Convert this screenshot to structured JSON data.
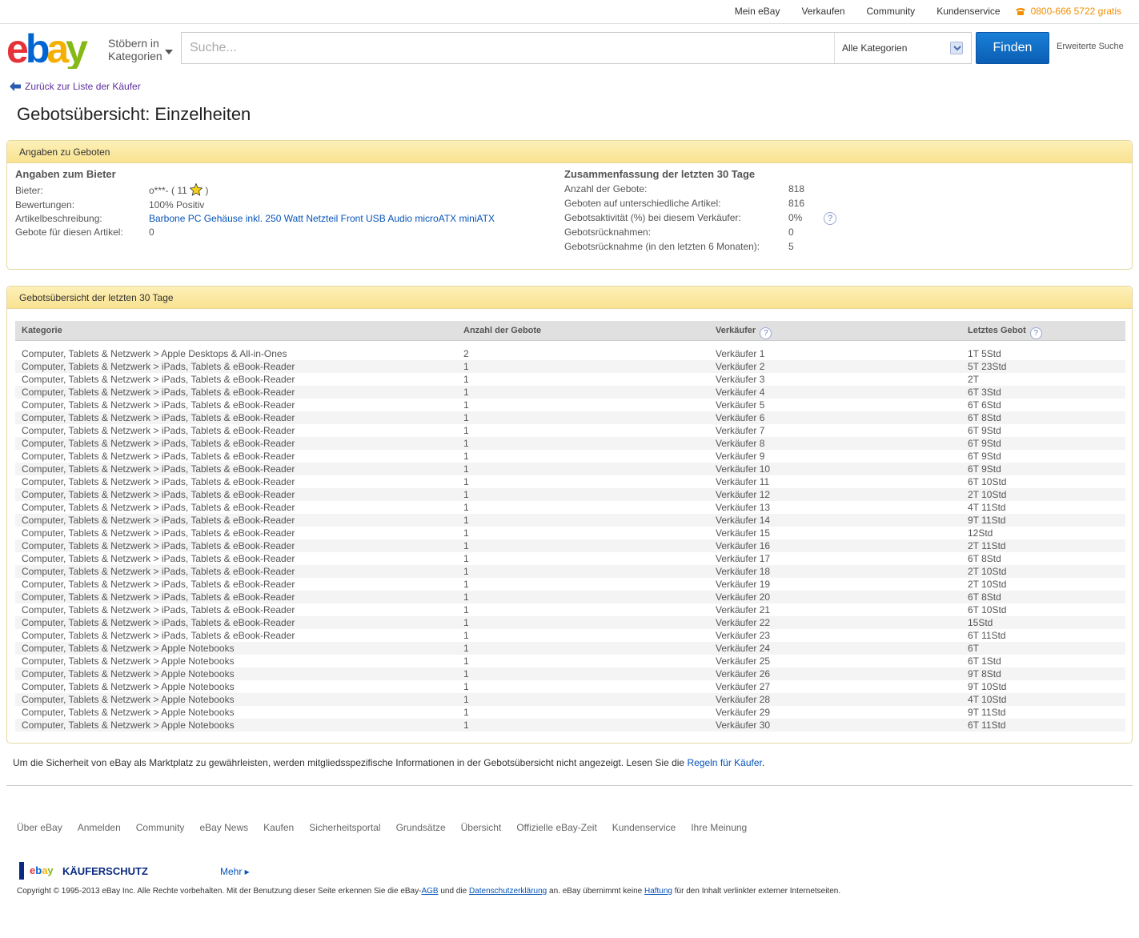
{
  "topnav": {
    "items": [
      "Mein eBay",
      "Verkaufen",
      "Community",
      "Kundenservice"
    ],
    "phone": "0800-666 5722 gratis"
  },
  "header": {
    "browse_line1": "Stöbern in",
    "browse_line2": "Kategorien",
    "search_placeholder": "Suche...",
    "category": "Alle Kategorien",
    "find_label": "Finden",
    "advanced_search": "Erweiterte Suche"
  },
  "back_link": "Zurück zur Liste der Käufer",
  "page_title": "Gebotsübersicht: Einzelheiten",
  "panel1": {
    "title": "Angaben zu Geboten",
    "bidder": {
      "heading": "Angaben zum Bieter",
      "bieter_label": "Bieter:",
      "bieter_value": "o***- ( 11",
      "bieter_close": ")",
      "bewertungen_label": "Bewertungen:",
      "bewertungen_value": "100% Positiv",
      "artikel_label": "Artikelbeschreibung:",
      "artikel_value": "Barbone PC Gehäuse inkl. 250 Watt Netzteil Front USB Audio microATX miniATX",
      "gebote_label": "Gebote für diesen Artikel:",
      "gebote_value": "0"
    },
    "summary": {
      "heading": "Zusammenfassung der letzten 30 Tage",
      "items": [
        {
          "label": "Anzahl der Gebote:",
          "value": "818"
        },
        {
          "label": "Geboten auf unterschiedliche Artikel:",
          "value": "816"
        },
        {
          "label": "Gebotsaktivität (%) bei diesem Verkäufer:",
          "value": "0%"
        },
        {
          "label": "Gebotsrücknahmen:",
          "value": "0"
        },
        {
          "label": "Gebotsrücknahme (in den letzten 6 Monaten):",
          "value": "5"
        }
      ]
    }
  },
  "panel2": {
    "title": "Gebotsübersicht der letzten 30 Tage",
    "columns": [
      "Kategorie",
      "Anzahl der Gebote",
      "Verkäufer",
      "Letztes Gebot"
    ],
    "rows": [
      [
        "Computer, Tablets & Netzwerk > Apple Desktops & All-in-Ones",
        "2",
        "Verkäufer 1",
        "1T 5Std"
      ],
      [
        "Computer, Tablets & Netzwerk > iPads, Tablets & eBook-Reader",
        "1",
        "Verkäufer 2",
        "5T 23Std"
      ],
      [
        "Computer, Tablets & Netzwerk > iPads, Tablets & eBook-Reader",
        "1",
        "Verkäufer 3",
        "2T"
      ],
      [
        "Computer, Tablets & Netzwerk > iPads, Tablets & eBook-Reader",
        "1",
        "Verkäufer 4",
        "6T 3Std"
      ],
      [
        "Computer, Tablets & Netzwerk > iPads, Tablets & eBook-Reader",
        "1",
        "Verkäufer 5",
        "6T 6Std"
      ],
      [
        "Computer, Tablets & Netzwerk > iPads, Tablets & eBook-Reader",
        "1",
        "Verkäufer 6",
        "6T 8Std"
      ],
      [
        "Computer, Tablets & Netzwerk > iPads, Tablets & eBook-Reader",
        "1",
        "Verkäufer 7",
        "6T 9Std"
      ],
      [
        "Computer, Tablets & Netzwerk > iPads, Tablets & eBook-Reader",
        "1",
        "Verkäufer 8",
        "6T 9Std"
      ],
      [
        "Computer, Tablets & Netzwerk > iPads, Tablets & eBook-Reader",
        "1",
        "Verkäufer 9",
        "6T 9Std"
      ],
      [
        "Computer, Tablets & Netzwerk > iPads, Tablets & eBook-Reader",
        "1",
        "Verkäufer 10",
        "6T 9Std"
      ],
      [
        "Computer, Tablets & Netzwerk > iPads, Tablets & eBook-Reader",
        "1",
        "Verkäufer 11",
        "6T 10Std"
      ],
      [
        "Computer, Tablets & Netzwerk > iPads, Tablets & eBook-Reader",
        "1",
        "Verkäufer 12",
        "2T 10Std"
      ],
      [
        "Computer, Tablets & Netzwerk > iPads, Tablets & eBook-Reader",
        "1",
        "Verkäufer 13",
        "4T 11Std"
      ],
      [
        "Computer, Tablets & Netzwerk > iPads, Tablets & eBook-Reader",
        "1",
        "Verkäufer 14",
        "9T 11Std"
      ],
      [
        "Computer, Tablets & Netzwerk > iPads, Tablets & eBook-Reader",
        "1",
        "Verkäufer 15",
        "12Std"
      ],
      [
        "Computer, Tablets & Netzwerk > iPads, Tablets & eBook-Reader",
        "1",
        "Verkäufer 16",
        "2T 11Std"
      ],
      [
        "Computer, Tablets & Netzwerk > iPads, Tablets & eBook-Reader",
        "1",
        "Verkäufer 17",
        "6T 8Std"
      ],
      [
        "Computer, Tablets & Netzwerk > iPads, Tablets & eBook-Reader",
        "1",
        "Verkäufer 18",
        "2T 10Std"
      ],
      [
        "Computer, Tablets & Netzwerk > iPads, Tablets & eBook-Reader",
        "1",
        "Verkäufer 19",
        "2T 10Std"
      ],
      [
        "Computer, Tablets & Netzwerk > iPads, Tablets & eBook-Reader",
        "1",
        "Verkäufer 20",
        "6T 8Std"
      ],
      [
        "Computer, Tablets & Netzwerk > iPads, Tablets & eBook-Reader",
        "1",
        "Verkäufer 21",
        "6T 10Std"
      ],
      [
        "Computer, Tablets & Netzwerk > iPads, Tablets & eBook-Reader",
        "1",
        "Verkäufer 22",
        "15Std"
      ],
      [
        "Computer, Tablets & Netzwerk > iPads, Tablets & eBook-Reader",
        "1",
        "Verkäufer 23",
        "6T 11Std"
      ],
      [
        "Computer, Tablets & Netzwerk > Apple Notebooks",
        "1",
        "Verkäufer 24",
        "6T"
      ],
      [
        "Computer, Tablets & Netzwerk > Apple Notebooks",
        "1",
        "Verkäufer 25",
        "6T 1Std"
      ],
      [
        "Computer, Tablets & Netzwerk > Apple Notebooks",
        "1",
        "Verkäufer 26",
        "9T 8Std"
      ],
      [
        "Computer, Tablets & Netzwerk > Apple Notebooks",
        "1",
        "Verkäufer 27",
        "9T 10Std"
      ],
      [
        "Computer, Tablets & Netzwerk > Apple Notebooks",
        "1",
        "Verkäufer 28",
        "4T 10Std"
      ],
      [
        "Computer, Tablets & Netzwerk > Apple Notebooks",
        "1",
        "Verkäufer 29",
        "9T 11Std"
      ],
      [
        "Computer, Tablets & Netzwerk > Apple Notebooks",
        "1",
        "Verkäufer 30",
        "6T 11Std"
      ]
    ]
  },
  "notice": {
    "text": "Um die Sicherheit von eBay als Marktplatz zu gewährleisten, werden mitgliedsspezifische Informationen in der Gebotsübersicht nicht angezeigt. Lesen Sie die",
    "link": "Regeln für Käufer",
    "end": "."
  },
  "footer": {
    "links": [
      "Über eBay",
      "Anmelden",
      "Community",
      "eBay News",
      "Kaufen",
      "Sicherheitsportal",
      "Grundsätze",
      "Übersicht",
      "Offizielle eBay-Zeit",
      "Kundenservice",
      "Ihre Meinung"
    ],
    "kaeuferschutz": "KÄUFERSCHUTZ",
    "logo_e": "e",
    "logo_b": "b",
    "logo_a": "a",
    "logo_y": "y",
    "mehr": "Mehr ▸",
    "copyright_1": "Copyright © 1995-2013 eBay Inc. Alle Rechte vorbehalten. Mit der Benutzung dieser Seite erkennen Sie die eBay-",
    "agb": "AGB",
    "copyright_2": "und die",
    "datenschutz": "Datenschutzerklärung",
    "copyright_3": "an. eBay übernimmt keine",
    "haftung": "Haftung",
    "copyright_4": "für den Inhalt verlinkter externer Internetseiten."
  },
  "colors": {
    "accent_blue": "#0654ba",
    "panel_header": "#fbe8a3",
    "phone_orange": "#f18e00"
  }
}
